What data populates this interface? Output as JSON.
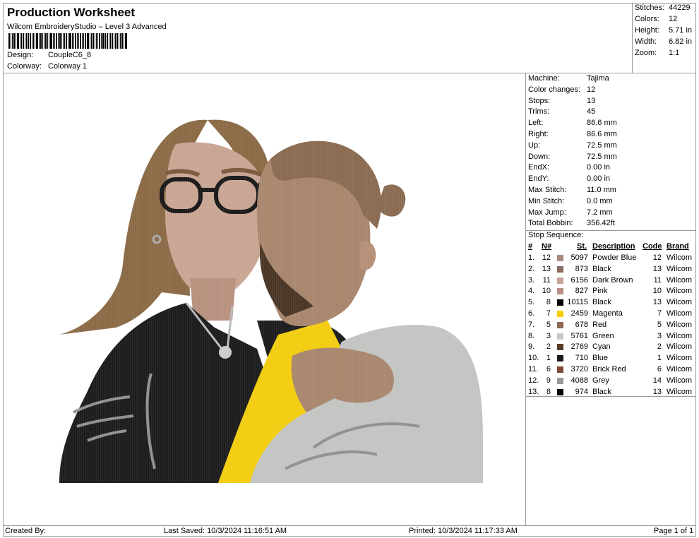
{
  "header": {
    "title": "Production Worksheet",
    "subtitle": "Wilcom EmbroideryStudio – Level 3 Advanced",
    "design_label": "Design:",
    "design_value": "CoupleC6_8",
    "colorway_label": "Colorway:",
    "colorway_value": "Colorway 1"
  },
  "stats": [
    {
      "label": "Stitches:",
      "value": "44229"
    },
    {
      "label": "Colors:",
      "value": "12"
    },
    {
      "label": "Height:",
      "value": "5.71 in"
    },
    {
      "label": "Width:",
      "value": "6.82 in"
    },
    {
      "label": "Zoom:",
      "value": "1:1"
    }
  ],
  "machine": [
    {
      "label": "Machine:",
      "value": "Tajima"
    },
    {
      "label": "Color changes:",
      "value": "12"
    },
    {
      "label": "Stops:",
      "value": "13"
    },
    {
      "label": "Trims:",
      "value": "45"
    },
    {
      "label": "Left:",
      "value": "86.6 mm"
    },
    {
      "label": "Right:",
      "value": "86.6 mm"
    },
    {
      "label": "Up:",
      "value": "72.5 mm"
    },
    {
      "label": "Down:",
      "value": "72.5 mm"
    },
    {
      "label": "EndX:",
      "value": "0.00 in"
    },
    {
      "label": "EndY:",
      "value": "0.00 in"
    },
    {
      "label": "Max Stitch:",
      "value": "11.0 mm"
    },
    {
      "label": "Min Stitch:",
      "value": "0.0 mm"
    },
    {
      "label": "Max Jump:",
      "value": "7.2 mm"
    },
    {
      "label": "Total Bobbin:",
      "value": "356.42ft"
    }
  ],
  "stop_sequence": {
    "label": "Stop Sequence:",
    "headers": {
      "idx": "#",
      "n": "N#",
      "st": "St.",
      "desc": "Description",
      "code": "Code",
      "brand": "Brand"
    },
    "rows": [
      {
        "idx": "1.",
        "n": "12",
        "color": "#a98a80",
        "st": "5097",
        "desc": "Powder Blue",
        "code": "12",
        "brand": "Wilcom"
      },
      {
        "idx": "2.",
        "n": "13",
        "color": "#8a6a5e",
        "st": "873",
        "desc": "Black",
        "code": "13",
        "brand": "Wilcom"
      },
      {
        "idx": "3.",
        "n": "11",
        "color": "#c4a29a",
        "st": "6156",
        "desc": "Dark Brown",
        "code": "11",
        "brand": "Wilcom"
      },
      {
        "idx": "4.",
        "n": "10",
        "color": "#b88f86",
        "st": "827",
        "desc": "Pink",
        "code": "10",
        "brand": "Wilcom"
      },
      {
        "idx": "5.",
        "n": "8",
        "color": "#000000",
        "st": "10115",
        "desc": "Black",
        "code": "13",
        "brand": "Wilcom"
      },
      {
        "idx": "6.",
        "n": "7",
        "color": "#f5d000",
        "st": "2459",
        "desc": "Magenta",
        "code": "7",
        "brand": "Wilcom"
      },
      {
        "idx": "7.",
        "n": "5",
        "color": "#8c6a52",
        "st": "678",
        "desc": "Red",
        "code": "5",
        "brand": "Wilcom"
      },
      {
        "idx": "8.",
        "n": "3",
        "color": "#c8c8c8",
        "st": "5761",
        "desc": "Green",
        "code": "3",
        "brand": "Wilcom"
      },
      {
        "idx": "9.",
        "n": "2",
        "color": "#5a3a28",
        "st": "2769",
        "desc": "Cyan",
        "code": "2",
        "brand": "Wilcom"
      },
      {
        "idx": "10.",
        "n": "1",
        "color": "#1a1a1a",
        "st": "710",
        "desc": "Blue",
        "code": "1",
        "brand": "Wilcom"
      },
      {
        "idx": "11.",
        "n": "6",
        "color": "#7a4a36",
        "st": "3720",
        "desc": "Brick Red",
        "code": "6",
        "brand": "Wilcom"
      },
      {
        "idx": "12.",
        "n": "9",
        "color": "#9a9a9a",
        "st": "4088",
        "desc": "Grey",
        "code": "14",
        "brand": "Wilcom"
      },
      {
        "idx": "13.",
        "n": "8",
        "color": "#000000",
        "st": "974",
        "desc": "Black",
        "code": "13",
        "brand": "Wilcom"
      }
    ]
  },
  "footer": {
    "created": "Created By:",
    "saved": "Last Saved: 10/3/2024 11:16:51 AM",
    "printed": "Printed: 10/3/2024 11:17:33 AM",
    "page": "Page 1 of 1"
  },
  "palette": {
    "hair_brown": "#8b6a46",
    "skin_left": "#c9a594",
    "skin_right": "#a8866e",
    "jacket_black": "#1d1d1d",
    "shirt_yellow": "#f2cd10",
    "hoodie_grey": "#c3c5c3",
    "hair_right": "#8a6b52"
  }
}
